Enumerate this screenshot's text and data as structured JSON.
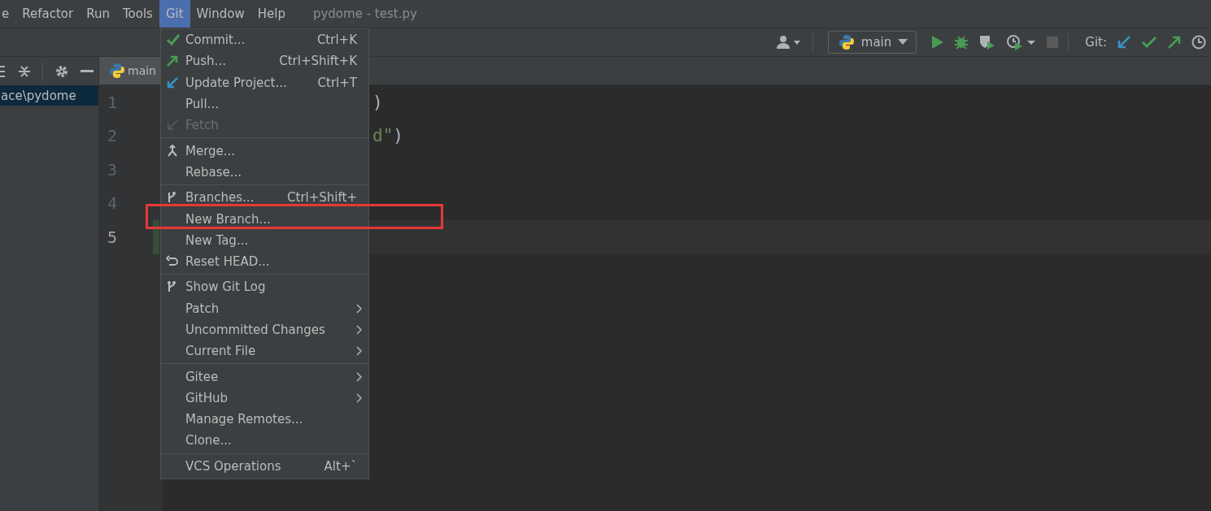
{
  "menu_bar": {
    "items": [
      {
        "label": "e",
        "selected": false
      },
      {
        "label": "Refactor",
        "selected": false
      },
      {
        "label": "Run",
        "selected": false
      },
      {
        "label": "Tools",
        "selected": false
      },
      {
        "label": "Git",
        "selected": true
      },
      {
        "label": "Window",
        "selected": false
      },
      {
        "label": "Help",
        "selected": false
      }
    ],
    "title": "pydome - test.py"
  },
  "toolbar": {
    "run_config": "main",
    "git_label": "Git:",
    "stop_disabled": true
  },
  "project_panel": {
    "items": [
      {
        "label": "ace\\pydome",
        "selected": true
      }
    ]
  },
  "editor": {
    "tab": "main",
    "lines": [
      {
        "number": "1",
        "current": false,
        "changed": false,
        "code": [
          {
            "kind": "plain",
            "text": ")"
          }
        ]
      },
      {
        "number": "2",
        "current": false,
        "changed": false,
        "code": [
          {
            "kind": "string",
            "text": "d\""
          },
          {
            "kind": "plain",
            "text": ")"
          }
        ]
      },
      {
        "number": "3",
        "current": false,
        "changed": false
      },
      {
        "number": "4",
        "current": false,
        "changed": false
      },
      {
        "number": "5",
        "current": true,
        "changed": true
      }
    ]
  },
  "git_menu": {
    "groups": [
      [
        {
          "label": "Commit...",
          "shortcut": "Ctrl+K",
          "kind": "commit",
          "disabled": false,
          "submenu": false
        },
        {
          "label": "Push...",
          "shortcut": "Ctrl+Shift+K",
          "kind": "push",
          "disabled": false,
          "submenu": false
        },
        {
          "label": "Update Project...",
          "shortcut": "Ctrl+T",
          "kind": "update",
          "disabled": false,
          "submenu": false
        },
        {
          "label": "Pull...",
          "kind": "plain",
          "disabled": false,
          "submenu": false
        },
        {
          "label": "Fetch",
          "kind": "fetch",
          "disabled": true,
          "submenu": false
        }
      ],
      [
        {
          "label": "Merge...",
          "kind": "merge",
          "disabled": false,
          "submenu": false
        },
        {
          "label": "Rebase...",
          "kind": "plain",
          "disabled": false,
          "submenu": false
        }
      ],
      [
        {
          "label": "Branches...",
          "shortcut": "Ctrl+Shift+",
          "kind": "branches",
          "disabled": false,
          "submenu": false
        },
        {
          "label": "New Branch...",
          "kind": "plain",
          "disabled": false,
          "submenu": false
        },
        {
          "label": "New Tag...",
          "kind": "plain",
          "disabled": false,
          "submenu": false
        },
        {
          "label": "Reset HEAD...",
          "kind": "reset",
          "disabled": false,
          "submenu": false
        }
      ],
      [
        {
          "label": "Show Git Log",
          "kind": "log",
          "disabled": false,
          "submenu": false
        },
        {
          "label": "Patch",
          "kind": "plain",
          "disabled": false,
          "submenu": true
        },
        {
          "label": "Uncommitted Changes",
          "kind": "plain",
          "disabled": false,
          "submenu": true
        },
        {
          "label": "Current File",
          "kind": "plain",
          "disabled": false,
          "submenu": true
        }
      ],
      [
        {
          "label": "Gitee",
          "kind": "plain",
          "disabled": false,
          "submenu": true
        },
        {
          "label": "GitHub",
          "kind": "plain",
          "disabled": false,
          "submenu": true
        },
        {
          "label": "Manage Remotes...",
          "kind": "plain",
          "disabled": false,
          "submenu": false
        },
        {
          "label": "Clone...",
          "kind": "plain",
          "disabled": false,
          "submenu": false
        }
      ],
      [
        {
          "label": "VCS Operations",
          "shortcut": "Alt+`",
          "kind": "plain",
          "disabled": false,
          "submenu": false
        }
      ]
    ]
  },
  "annotation": {
    "kind": "frame",
    "color": "#e53935"
  }
}
